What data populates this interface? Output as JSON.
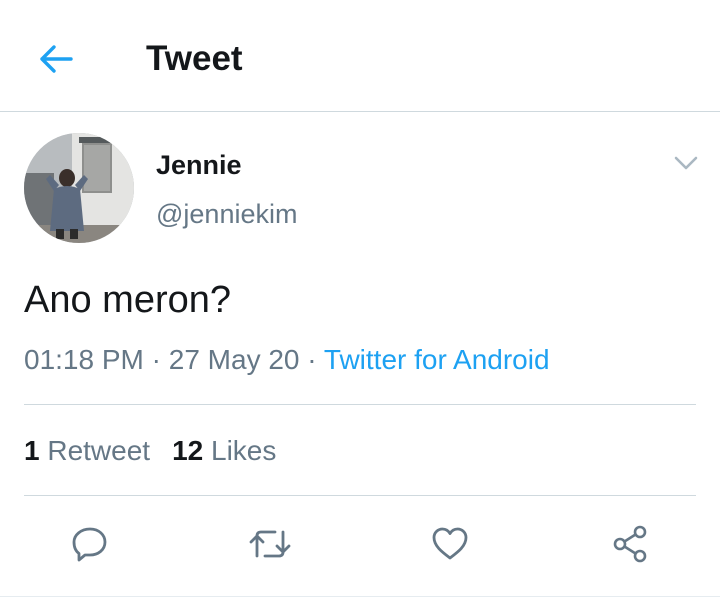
{
  "header": {
    "title": "Tweet",
    "back_icon": "arrow-left-icon"
  },
  "tweet": {
    "author_name": "Jennie",
    "author_handle": "@jenniekim",
    "text": "Ano meron?",
    "time": "01:18 PM",
    "separator": "·",
    "date": "27 May 20",
    "source": "Twitter for Android"
  },
  "stats": {
    "retweets_count": "1",
    "retweets_label": "Retweet",
    "likes_count": "12",
    "likes_label": "Likes"
  },
  "actions": [
    {
      "name": "reply",
      "icon": "reply-icon"
    },
    {
      "name": "retweet",
      "icon": "retweet-icon"
    },
    {
      "name": "like",
      "icon": "heart-icon"
    },
    {
      "name": "share",
      "icon": "share-icon"
    }
  ],
  "colors": {
    "accent": "#1da1f2",
    "text": "#14171a",
    "secondary": "#657786",
    "divider": "#cfd9de"
  }
}
